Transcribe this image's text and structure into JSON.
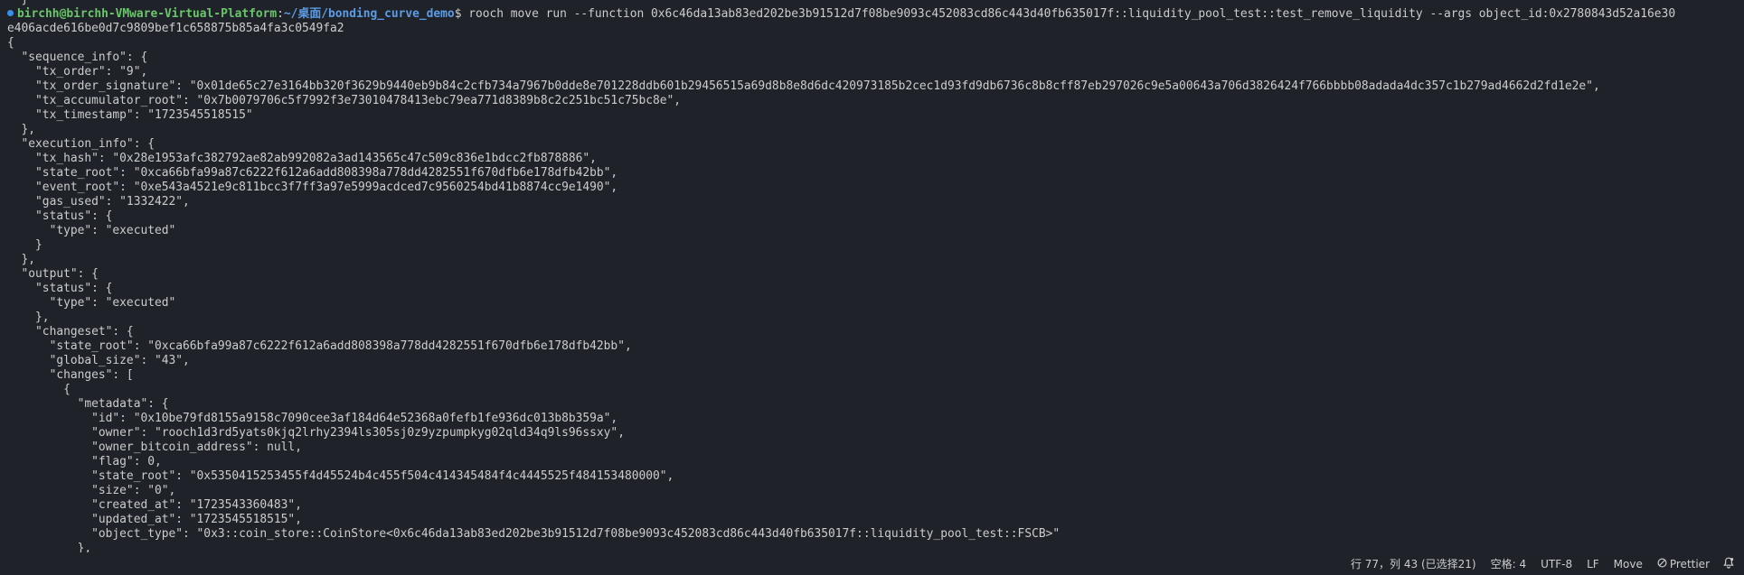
{
  "terminal": {
    "prompt": {
      "user_host": "birchh@birchh-VMware-Virtual-Platform",
      "separator": ":",
      "path": "~/桌面/bonding_curve_demo",
      "symbol": "$ "
    },
    "command_line_1": "rooch move run --function 0x6c46da13ab83ed202be3b91512d7f08be9093c452083cd86c443d40fb635017f::liquidity_pool_test::test_remove_liquidity --args object_id:0x2780843d52a16e30",
    "command_line_2": "e406acde616be0d7c9809bef1c658875b85a4fa3c0549fa2",
    "output_lines": [
      "{",
      "  \"sequence_info\": {",
      "    \"tx_order\": \"9\",",
      "    \"tx_order_signature\": \"0x01de65c27e3164bb320f3629b9440eb9b84c2cfb734a7967b0dde8e701228ddb601b29456515a69d8b8e8d6dc420973185b2cec1d93fd9db6736c8b8cff87eb297026c9e5a00643a706d3826424f766bbbb08adada4dc357c1b279ad4662d2fd1e2e\",",
      "    \"tx_accumulator_root\": \"0x7b0079706c5f7992f3e73010478413ebc79ea771d8389b8c2c251bc51c75bc8e\",",
      "    \"tx_timestamp\": \"1723545518515\"",
      "  },",
      "  \"execution_info\": {",
      "    \"tx_hash\": \"0x28e1953afc382792ae82ab992082a3ad143565c47c509c836e1bdcc2fb878886\",",
      "    \"state_root\": \"0xca66bfa99a87c6222f612a6add808398a778dd4282551f670dfb6e178dfb42bb\",",
      "    \"event_root\": \"0xe543a4521e9c811bcc3f7ff3a97e5999acdced7c9560254bd41b8874cc9e1490\",",
      "    \"gas_used\": \"1332422\",",
      "    \"status\": {",
      "      \"type\": \"executed\"",
      "    }",
      "  },",
      "  \"output\": {",
      "    \"status\": {",
      "      \"type\": \"executed\"",
      "    },",
      "    \"changeset\": {",
      "      \"state_root\": \"0xca66bfa99a87c6222f612a6add808398a778dd4282551f670dfb6e178dfb42bb\",",
      "      \"global_size\": \"43\",",
      "      \"changes\": [",
      "        {",
      "          \"metadata\": {",
      "            \"id\": \"0x10be79fd8155a9158c7090cee3af184d64e52368a0fefb1fe936dc013b8b359a\",",
      "            \"owner\": \"rooch1d3rd5yats0kjq2lrhy2394ls305sj0z9yzpumpkyg02qld34q9ls96ssxy\",",
      "            \"owner_bitcoin_address\": null,",
      "            \"flag\": 0,",
      "            \"state_root\": \"0x5350415253455f4d45524b4c455f504c414345484f4c4445525f484153480000\",",
      "            \"size\": \"0\",",
      "            \"created_at\": \"1723543360483\",",
      "            \"updated_at\": \"1723545518515\",",
      "            \"object_type\": \"0x3::coin_store::CoinStore<0x6c46da13ab83ed202be3b91512d7f08be9093c452083cd86c443d40fb635017f::liquidity_pool_test::FSCB>\"",
      "          },"
    ]
  },
  "statusbar": {
    "cursor_position": "行 77，列 43 (已选择21)",
    "indentation": "空格: 4",
    "encoding": "UTF-8",
    "line_ending": "LF",
    "language": "Move",
    "formatter": "Prettier",
    "formatter_icon": "circle-slash-icon",
    "notification_icon": "bell-icon"
  }
}
